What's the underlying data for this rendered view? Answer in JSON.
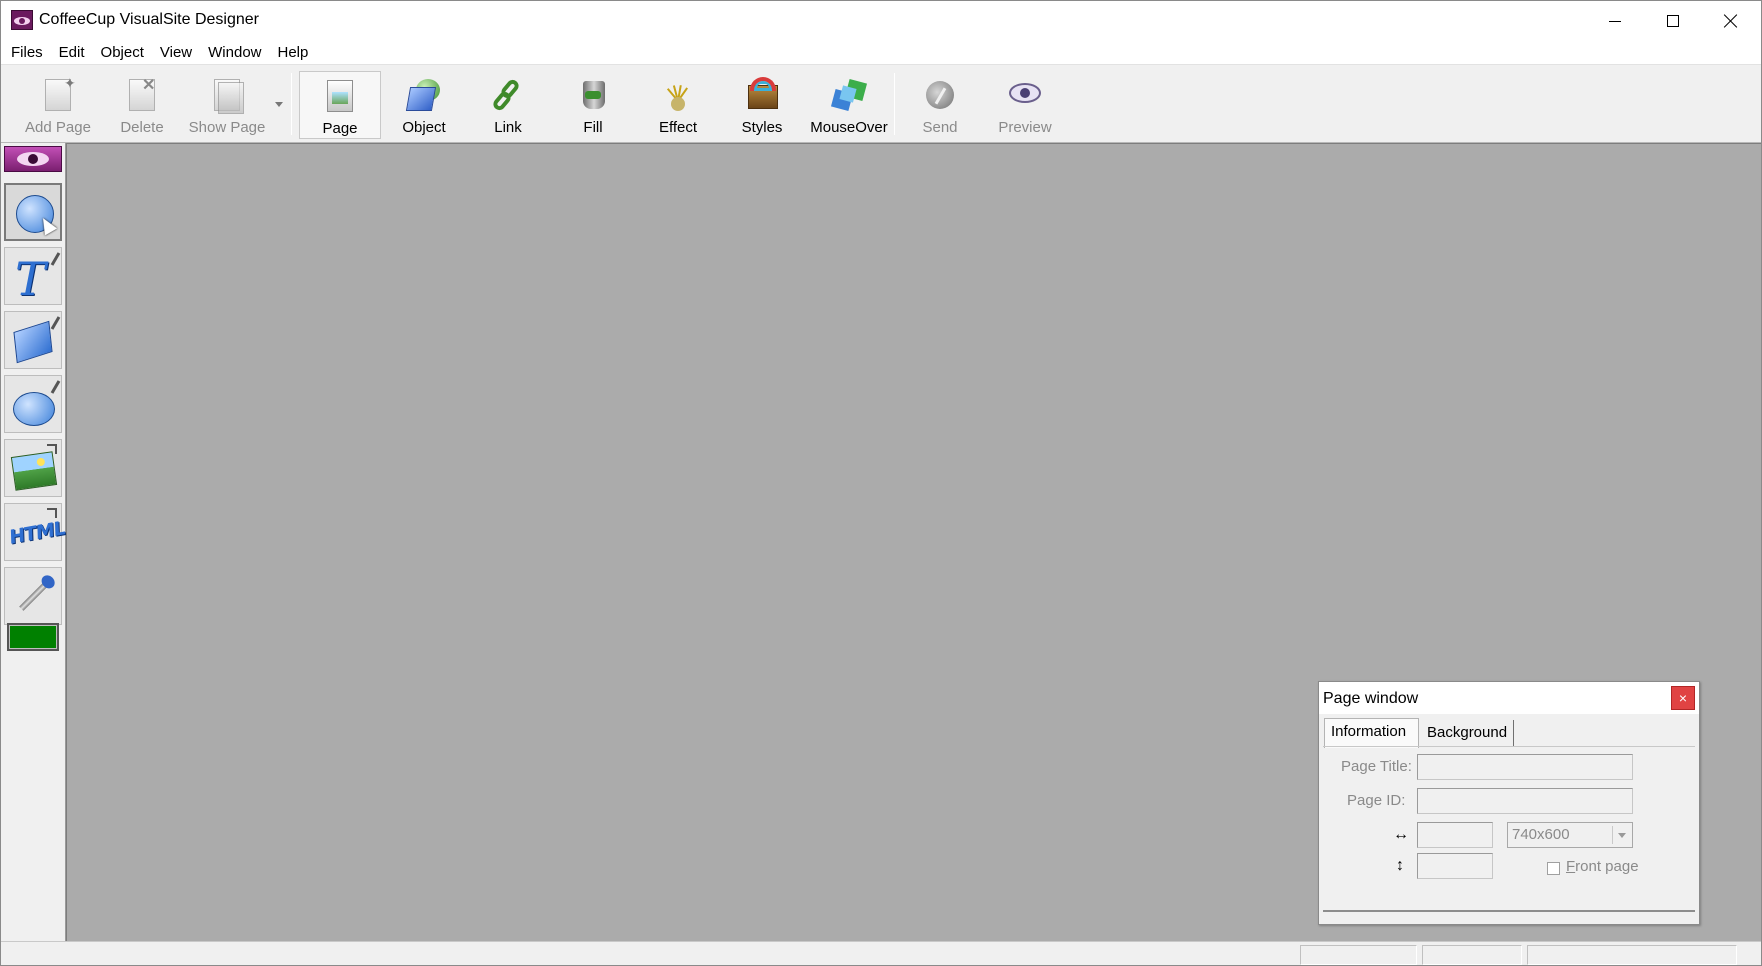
{
  "window": {
    "title": "CoffeeCup VisualSite Designer",
    "app_icon": "eye-logo-icon"
  },
  "menu": [
    "Files",
    "Edit",
    "Object",
    "View",
    "Window",
    "Help"
  ],
  "toolbar": {
    "add_page": {
      "label": "Add Page",
      "icon": "add-page-icon",
      "enabled": false
    },
    "delete": {
      "label": "Delete",
      "icon": "delete-page-icon",
      "enabled": false
    },
    "show_page": {
      "label": "Show Page",
      "icon": "show-page-icon",
      "enabled": false
    },
    "page": {
      "label": "Page",
      "icon": "page-icon",
      "active": true
    },
    "object": {
      "label": "Object",
      "icon": "object-icon"
    },
    "link": {
      "label": "Link",
      "icon": "link-chain-icon"
    },
    "fill": {
      "label": "Fill",
      "icon": "fill-bucket-icon"
    },
    "effect": {
      "label": "Effect",
      "icon": "effect-sparkle-icon"
    },
    "styles": {
      "label": "Styles",
      "icon": "styles-box-icon"
    },
    "mouseover": {
      "label": "MouseOver",
      "icon": "mouseover-icon"
    },
    "send": {
      "label": "Send",
      "icon": "send-icon",
      "enabled": false
    },
    "preview": {
      "label": "Preview",
      "icon": "preview-eye-icon",
      "enabled": false
    }
  },
  "toolbox": {
    "tools": [
      "select-tool",
      "text-tool",
      "rectangle-tool",
      "ellipse-tool",
      "image-tool",
      "html-tool",
      "eyedropper-tool"
    ],
    "selected": "select-tool",
    "current_color": "#008000"
  },
  "canvas": {
    "background": "#ababab"
  },
  "page_window": {
    "title": "Page window",
    "close_glyph": "×",
    "tabs": [
      "Information",
      "Background"
    ],
    "active_tab": "Information",
    "page_title_label": "Page Title:",
    "page_title_value": "",
    "page_id_label": "Page ID:",
    "page_id_value": "",
    "width_icon": "↔",
    "height_icon": "↕",
    "width_value": "",
    "height_value": "",
    "size_preset": "740x600",
    "front_page_label_first": "F",
    "front_page_label_rest": "ront page",
    "front_page_checked": false
  }
}
